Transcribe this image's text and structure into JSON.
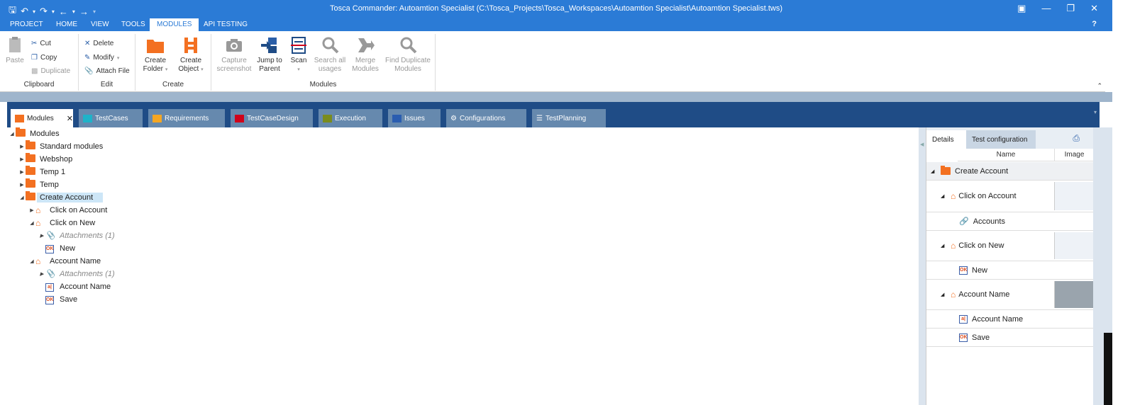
{
  "window": {
    "title": "Tosca Commander: Autoamtion Specialist (C:\\Tosca_Projects\\Tosca_Workspaces\\Autoamtion Specialist\\Autoamtion Specialist.tws)"
  },
  "menu": {
    "items": [
      "PROJECT",
      "HOME",
      "VIEW",
      "TOOLS",
      "MODULES",
      "API TESTING"
    ],
    "active": "MODULES",
    "help": "?"
  },
  "ribbon": {
    "clipboard": {
      "label": "Clipboard",
      "paste": "Paste",
      "cut": "Cut",
      "copy": "Copy",
      "duplicate": "Duplicate"
    },
    "edit": {
      "label": "Edit",
      "delete": "Delete",
      "modify": "Modify",
      "attach_file": "Attach File"
    },
    "create": {
      "label": "Create",
      "create_folder_1": "Create",
      "create_folder_2": "Folder",
      "create_object_1": "Create",
      "create_object_2": "Object"
    },
    "modules": {
      "label": "Modules",
      "capture_1": "Capture",
      "capture_2": "screenshot",
      "jump_1": "Jump to",
      "jump_2": "Parent",
      "scan": "Scan",
      "search_1": "Search all",
      "search_2": "usages",
      "merge_1": "Merge",
      "merge_2": "Modules",
      "find_1": "Find Duplicate",
      "find_2": "Modules"
    }
  },
  "tabs": [
    {
      "label": "Modules",
      "color": "#f37021"
    },
    {
      "label": "TestCases",
      "color": "#1fb3c9"
    },
    {
      "label": "Requirements",
      "color": "#f5a623"
    },
    {
      "label": "TestCaseDesign",
      "color": "#d0021b"
    },
    {
      "label": "Execution",
      "color": "#7a8c1e"
    },
    {
      "label": "Issues",
      "color": "#2a5db0"
    },
    {
      "label": "Configurations",
      "color": "#ffffff"
    },
    {
      "label": "TestPlanning",
      "color": "#ffffff"
    }
  ],
  "tree": {
    "root": "Modules",
    "standard_modules": "Standard modules",
    "webshop": "Webshop",
    "temp1": "Temp 1",
    "temp": "Temp",
    "create_account": "Create Account",
    "click_on_account": "Click on Account",
    "click_on_new": "Click on New",
    "attachments_1": "Attachments (1)",
    "new": "New",
    "account_name_module": "Account Name",
    "attachments_2": "Attachments (1)",
    "account_name_field": "Account Name",
    "save": "Save"
  },
  "details": {
    "tab_details": "Details",
    "tab_test_config": "Test configuration",
    "col_name": "Name",
    "col_image": "Image",
    "rows": {
      "create_account": "Create Account",
      "click_on_account": "Click on Account",
      "accounts": "Accounts",
      "click_on_new": "Click on New",
      "new": "New",
      "account_name_module": "Account Name",
      "account_name_field": "Account Name",
      "save": "Save"
    }
  }
}
